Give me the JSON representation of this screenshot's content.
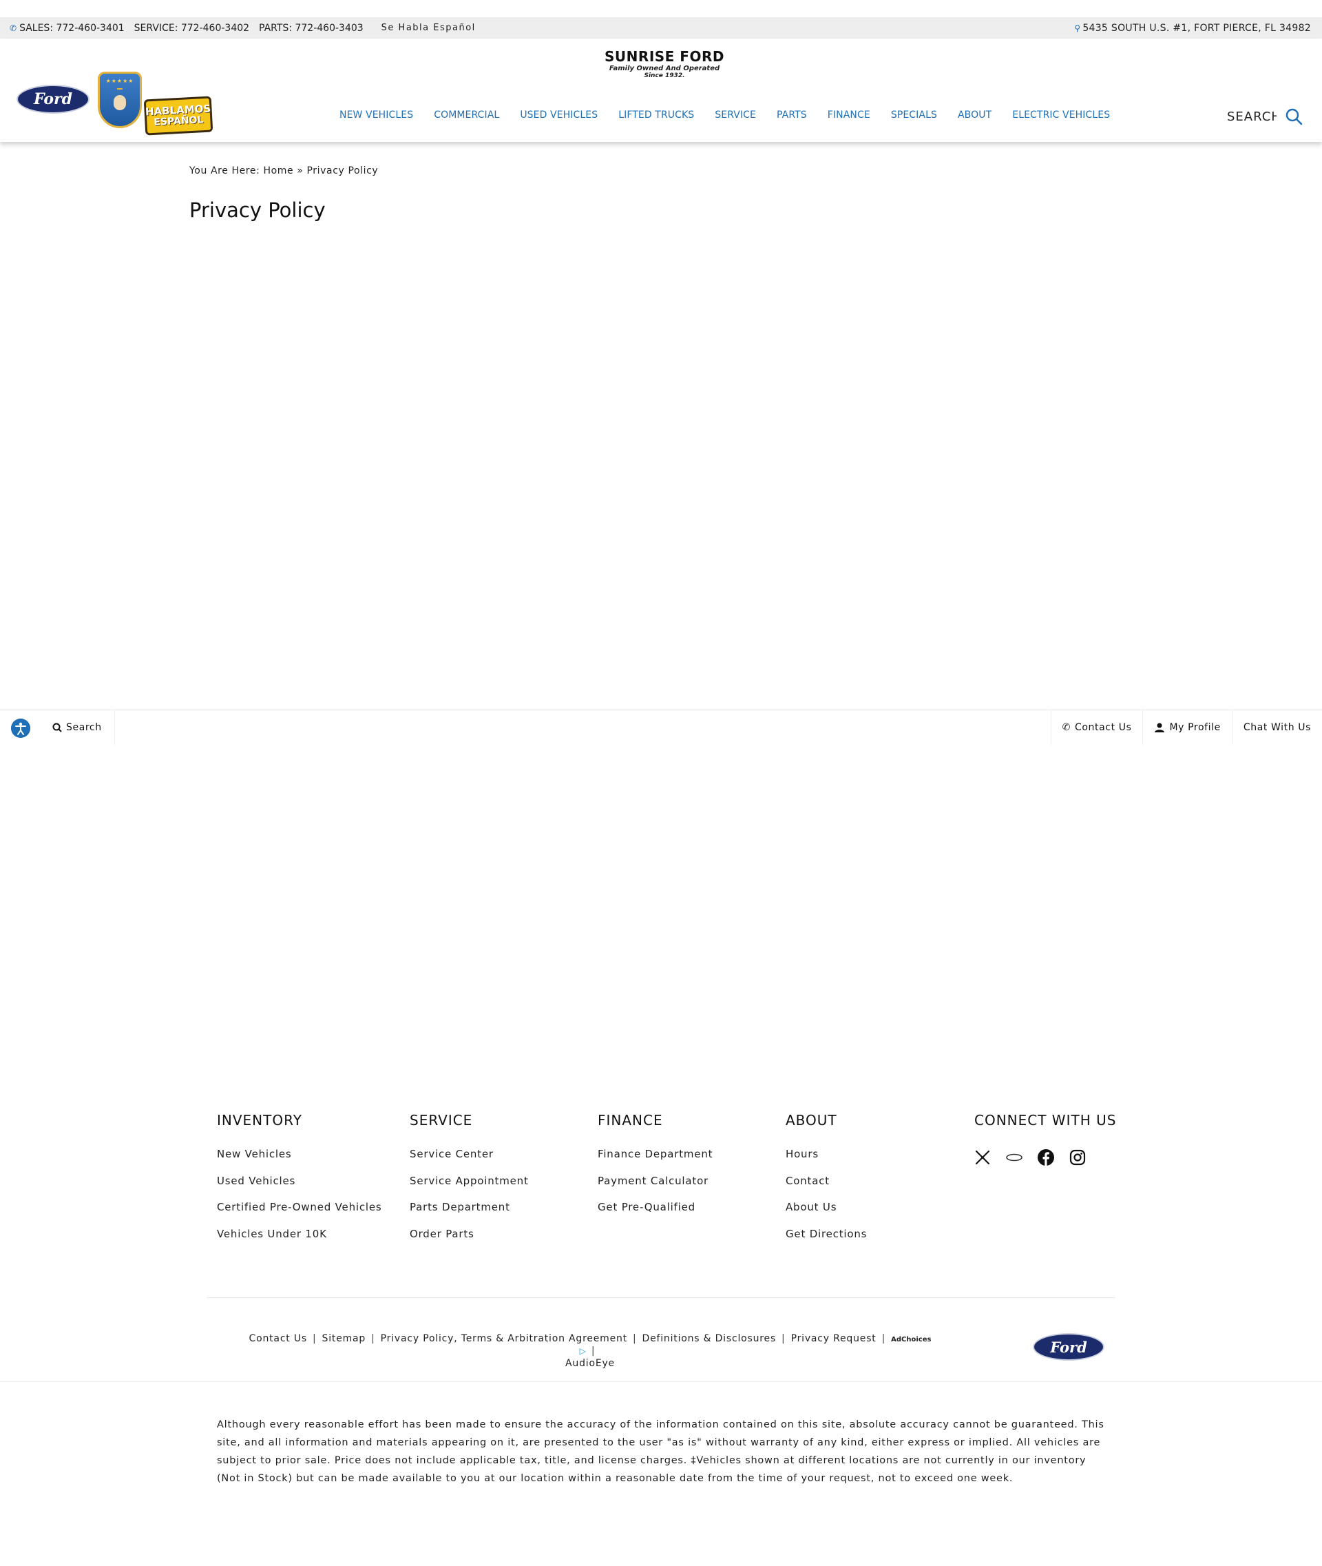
{
  "topbar": {
    "sales": "SALES: 772-460-3401",
    "service": "SERVICE: 772-460-3402",
    "parts": "PARTS: 772-460-3403",
    "habla": "Se Habla Español",
    "address": "5435 SOUTH U.S. #1, FORT PIERCE, FL 34982"
  },
  "header": {
    "ford_logo": "Ford",
    "hablamos_line1": "HABLAMOS",
    "hablamos_line2": "ESPAÑOL",
    "brand_name": "SUNRISE FORD",
    "brand_tag1": "Family Owned And Operated",
    "brand_tag2": "Since 1932.",
    "search_label": "SEARCH",
    "nav": [
      "NEW VEHICLES",
      "COMMERCIAL",
      "USED VEHICLES",
      "LIFTED TRUCKS",
      "SERVICE",
      "PARTS",
      "FINANCE",
      "SPECIALS",
      "ABOUT",
      "ELECTRIC VEHICLES"
    ]
  },
  "content": {
    "breadcrumb_prefix": "You Are Here:",
    "breadcrumb_home": "Home",
    "breadcrumb_sep": "»",
    "breadcrumb_current": "Privacy Policy",
    "title": "Privacy Policy"
  },
  "sticky": {
    "search": "Search",
    "contact": "Contact Us",
    "profile": "My Profile",
    "chat": "Chat With Us"
  },
  "footer": {
    "inventory": {
      "head": "INVENTORY",
      "links": [
        "New Vehicles",
        "Used Vehicles",
        "Certified Pre-Owned Vehicles",
        "Vehicles Under 10K"
      ]
    },
    "service": {
      "head": "SERVICE",
      "links": [
        "Service Center",
        "Service Appointment",
        "Parts Department",
        "Order Parts"
      ]
    },
    "finance": {
      "head": "FINANCE",
      "links": [
        "Finance Department",
        "Payment Calculator",
        "Get Pre-Qualified"
      ]
    },
    "about": {
      "head": "ABOUT",
      "links": [
        "Hours",
        "Contact",
        "About Us",
        "Get Directions"
      ]
    },
    "connect": {
      "head": "CONNECT WITH US"
    },
    "legal": {
      "contact": "Contact Us",
      "sitemap": "Sitemap",
      "privacy": "Privacy Policy, Terms & Arbitration Agreement",
      "definitions": "Definitions & Disclosures",
      "privacy_request": "Privacy Request",
      "adchoices": "AdChoices",
      "audioeye": "AudioEye"
    },
    "ford_logo": "Ford",
    "disclaimer": "Although every reasonable effort has been made to ensure the accuracy of the information contained on this site, absolute accuracy cannot be guaranteed. This site, and all information and materials appearing on it, are presented to the user \"as is\" without warranty of any kind, either express or implied. All vehicles are subject to prior sale. Price does not include applicable tax, title, and license charges. ‡Vehicles shown at different locations are not currently in our inventory (Not in Stock) but can be made available to you at our location within a reasonable date from the time of your request, not to exceed one week."
  },
  "colors": {
    "accent": "#1f6fb6",
    "ford_blue": "#1c2b6b",
    "topbar_bg": "#eeeeee"
  }
}
